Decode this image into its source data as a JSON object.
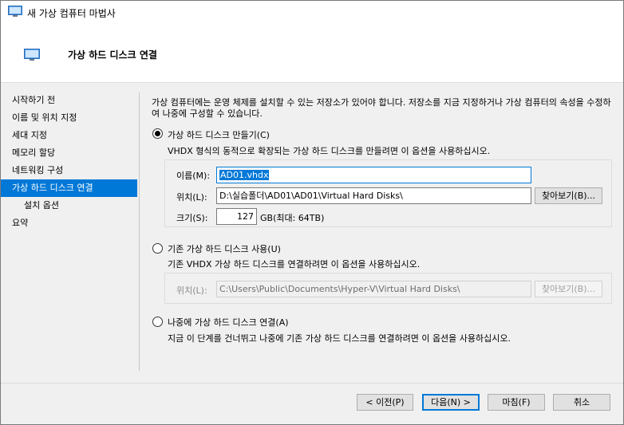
{
  "window": {
    "title": "새 가상 컴퓨터 마법사"
  },
  "header": {
    "title": "가상 하드 디스크 연결"
  },
  "nav": {
    "items": [
      {
        "label": "시작하기 전"
      },
      {
        "label": "이름 및 위치 지정"
      },
      {
        "label": "세대 지정"
      },
      {
        "label": "메모리 할당"
      },
      {
        "label": "네트워킹 구성"
      },
      {
        "label": "가상 하드 디스크 연결",
        "selected": true
      },
      {
        "label": "설치 옵션",
        "indent": true
      },
      {
        "label": "요약"
      }
    ]
  },
  "content": {
    "description": "가상 컴퓨터에는 운영 체제를 설치할 수 있는 저장소가 있어야 합니다. 저장소를 지금 지정하거나 가상 컴퓨터의 속성을 수정하여 나중에 구성할 수 있습니다.",
    "option_create": {
      "label": "가상 하드 디스크 만들기(C)",
      "selected": true,
      "description": "VHDX 형식의 동적으로 확장되는 가상 하드 디스크를 만들려면 이 옵션을 사용하십시오.",
      "name_label": "이름(M):",
      "name_value": "AD01.vhdx",
      "location_label": "위치(L):",
      "location_value": "D:\\실습폴더\\AD01\\AD01\\Virtual Hard Disks\\",
      "browse_label": "찾아보기(B)...",
      "size_label": "크기(S):",
      "size_value": "127",
      "size_unit": "GB(최대: 64TB)"
    },
    "option_existing": {
      "label": "기존 가상 하드 디스크 사용(U)",
      "selected": false,
      "description": "기존 VHDX 가상 하드 디스크를 연결하려면 이 옵션을 사용하십시오.",
      "location_label": "위치(L):",
      "location_value": "C:\\Users\\Public\\Documents\\Hyper-V\\Virtual Hard Disks\\",
      "browse_label": "찾아보기(B)..."
    },
    "option_later": {
      "label": "나중에 가상 하드 디스크 연결(A)",
      "selected": false,
      "description": "지금 이 단계를 건너뛰고 나중에 기존 가상 하드 디스크를 연결하려면 이 옵션을 사용하십시오."
    }
  },
  "footer": {
    "prev_label": "< 이전(P)",
    "next_label": "다음(N) >",
    "finish_label": "마침(F)",
    "cancel_label": "취소"
  },
  "colors": {
    "accent": "#0078d7",
    "window_bg": "#f0f0f0"
  }
}
